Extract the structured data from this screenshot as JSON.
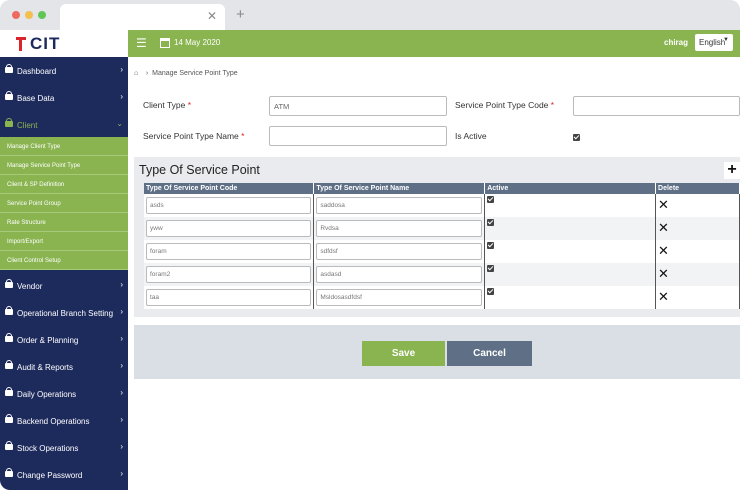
{
  "colors": {
    "sidebar": "#1d2a5c",
    "accent": "#8ab450",
    "header": "#5e6f86",
    "cancel": "#5e6f86",
    "save": "#8ab450"
  },
  "app": {
    "logo": "CIT"
  },
  "topbar": {
    "date": "14 May 2020",
    "user": "chirag",
    "language": "English"
  },
  "sidebar": {
    "items": [
      {
        "label": "Dashboard",
        "icon": "lock-icon"
      },
      {
        "label": "Base Data",
        "icon": "lock-icon"
      },
      {
        "label": "Client",
        "icon": "lock-icon",
        "expanded": true
      },
      {
        "label": "Vendor",
        "icon": "lock-icon"
      },
      {
        "label": "Operational Branch Setting",
        "icon": "lock-icon"
      },
      {
        "label": "Order & Planning",
        "icon": "lock-icon"
      },
      {
        "label": "Audit & Reports",
        "icon": "lock-icon"
      },
      {
        "label": "Daily Operations",
        "icon": "lock-icon"
      },
      {
        "label": "Backend Operations",
        "icon": "lock-icon"
      },
      {
        "label": "Stock Operations",
        "icon": "lock-icon"
      },
      {
        "label": "Change Password",
        "icon": "lock-icon"
      }
    ],
    "sub_items": [
      "Manage Client Type",
      "Manage Service Point Type",
      "Client & SP Definition",
      "Service Point Group",
      "Rate Structure",
      "Import/Export",
      "Client Control Setup"
    ]
  },
  "breadcrumb": {
    "current": "Manage Service Point Type"
  },
  "form": {
    "client_type_label": "Client Type",
    "client_type_value": "ATM",
    "spt_code_label": "Service Point Type Code",
    "spt_code_value": "",
    "spt_name_label": "Service Point Type Name",
    "spt_name_value": "",
    "is_active_label": "Is Active",
    "is_active": true
  },
  "grid": {
    "title": "Type Of Service Point",
    "add_label": "+",
    "columns": [
      "Type Of Service Point Code",
      "Type Of Service Point Name",
      "Active",
      "Delete"
    ],
    "rows": [
      {
        "code": "asds",
        "name": "saddosa",
        "active": true
      },
      {
        "code": "yww",
        "name": "Rvdsa",
        "active": true
      },
      {
        "code": "foram",
        "name": "sdfdsf",
        "active": true
      },
      {
        "code": "foram2",
        "name": "asdasd",
        "active": true
      },
      {
        "code": "taa",
        "name": "Msldosasdfdsf",
        "active": true
      }
    ]
  },
  "actions": {
    "save": "Save",
    "cancel": "Cancel"
  }
}
